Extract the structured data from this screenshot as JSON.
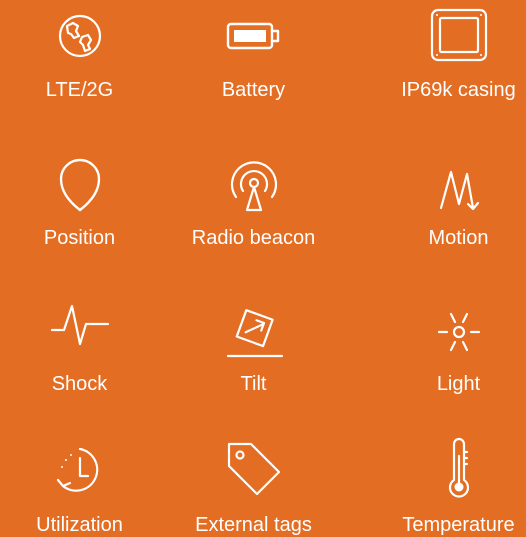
{
  "colors": {
    "background": "#E36D22",
    "foreground": "#FFFFFF"
  },
  "features": [
    {
      "label": "LTE/2G",
      "icon": "globe-icon"
    },
    {
      "label": "Battery",
      "icon": "battery-icon"
    },
    {
      "label": "IP69k casing",
      "icon": "casing-icon"
    },
    {
      "label": "Position",
      "icon": "location-pin-icon"
    },
    {
      "label": "Radio beacon",
      "icon": "radio-beacon-icon"
    },
    {
      "label": "Motion",
      "icon": "motion-icon"
    },
    {
      "label": "Shock",
      "icon": "shock-pulse-icon"
    },
    {
      "label": "Tilt",
      "icon": "tilt-icon"
    },
    {
      "label": "Light",
      "icon": "light-icon"
    },
    {
      "label": "Utilization",
      "icon": "timer-icon"
    },
    {
      "label": "External tags",
      "icon": "tag-icon"
    },
    {
      "label": "Temperature",
      "icon": "thermometer-icon"
    }
  ]
}
